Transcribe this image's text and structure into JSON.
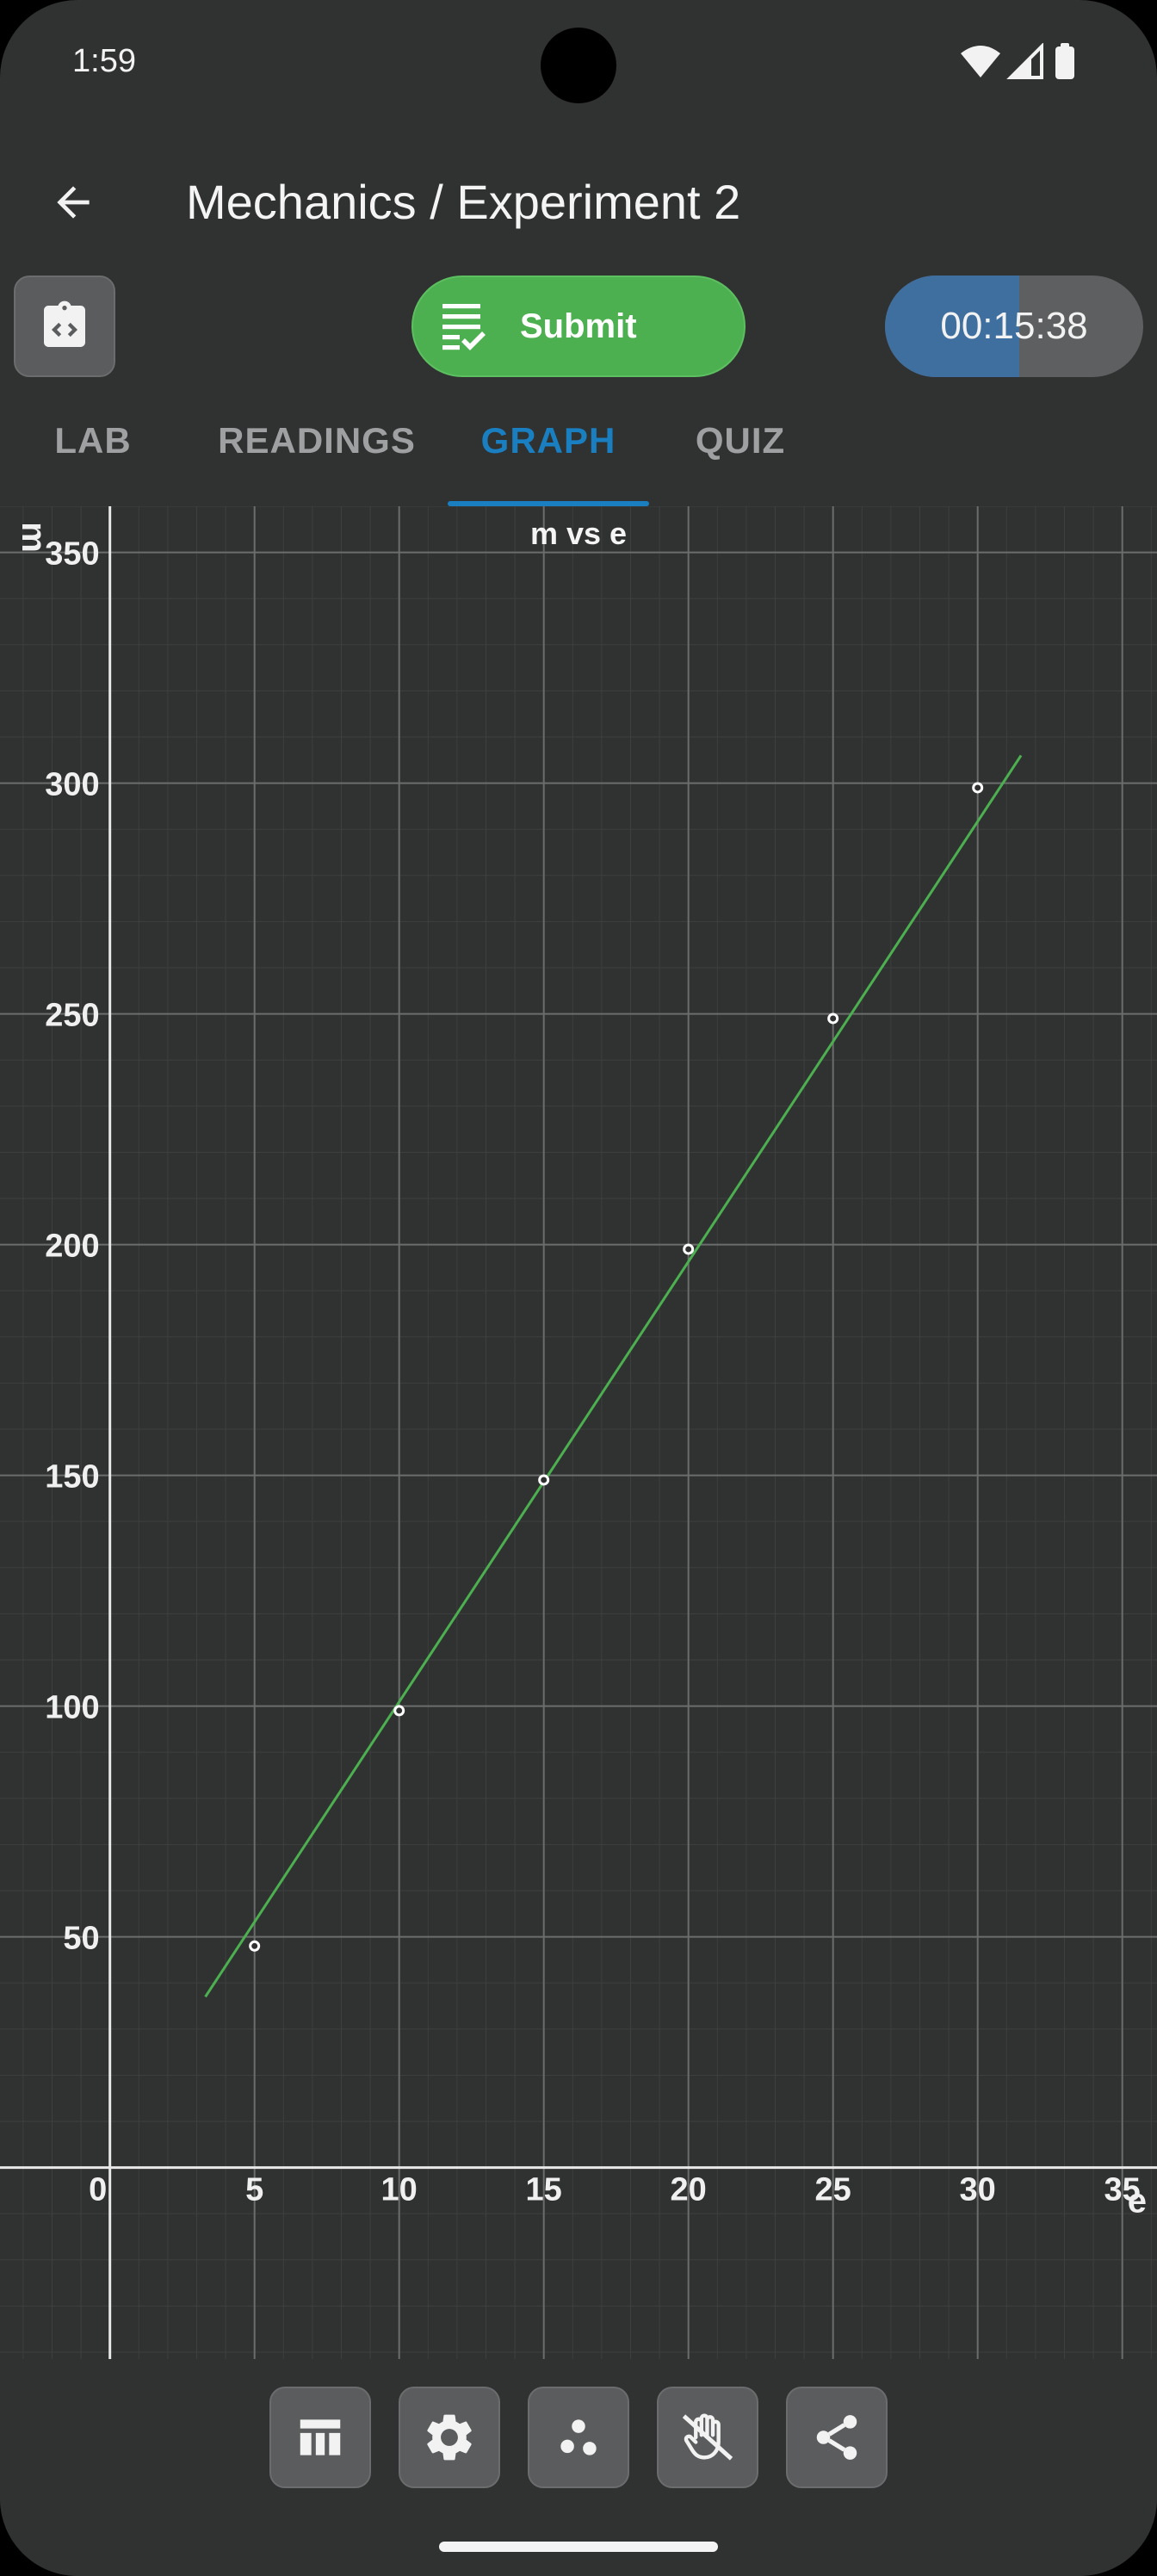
{
  "status_bar": {
    "time": "1:59"
  },
  "app_bar": {
    "title": "Mechanics / Experiment 2"
  },
  "toolbar": {
    "submit_label": "Submit",
    "timer": {
      "value": "00:15:38",
      "progress": 0.52
    }
  },
  "tabs": [
    {
      "label": "LAB",
      "active": false
    },
    {
      "label": "READINGS",
      "active": false
    },
    {
      "label": "GRAPH",
      "active": true
    },
    {
      "label": "QUIZ",
      "active": false
    }
  ],
  "colors": {
    "accent": "#1a7fc0",
    "submit": "#4caf50",
    "fit_line": "#4caf50",
    "points": "#ffffff",
    "background": "#303131"
  },
  "chart_data": {
    "type": "scatter",
    "title": "m vs e",
    "xlabel": "e",
    "ylabel": "m",
    "xlim": [
      -3.8,
      36.2
    ],
    "ylim": [
      -41.5,
      360
    ],
    "x_ticks": [
      0,
      5,
      10,
      15,
      20,
      25,
      30,
      35
    ],
    "y_ticks": [
      50,
      100,
      150,
      200,
      250,
      300,
      350
    ],
    "grid": true,
    "series": [
      {
        "type": "scatter",
        "x": [
          5,
          10,
          15,
          20,
          25,
          30
        ],
        "y": [
          48,
          99,
          149,
          199,
          249,
          299
        ]
      },
      {
        "type": "line",
        "x": [
          3.3,
          31.5
        ],
        "y": [
          37,
          306
        ]
      }
    ]
  },
  "bottom_tools": [
    {
      "name": "table-icon"
    },
    {
      "name": "gear-icon"
    },
    {
      "name": "scatter-icon"
    },
    {
      "name": "hand-icon"
    },
    {
      "name": "share-icon"
    }
  ]
}
